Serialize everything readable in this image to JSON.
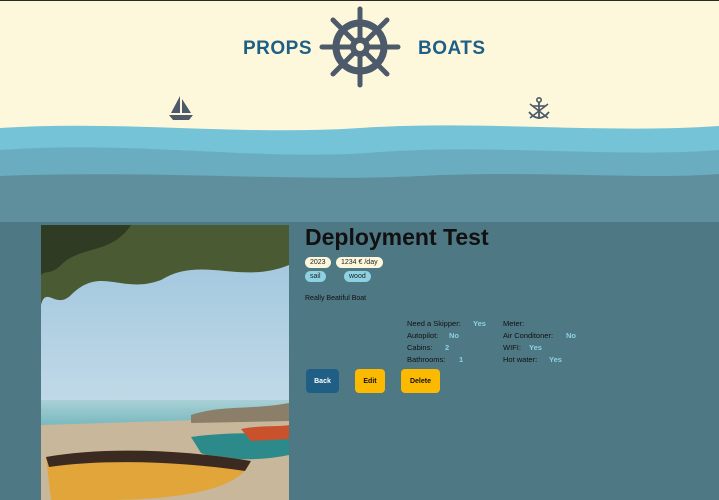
{
  "header": {
    "brand_left": "PROPS",
    "brand_right": "BOATS",
    "logo_icon": "ship-wheel-icon",
    "left_icon": "sailboat-icon",
    "right_icon": "anchor-icon"
  },
  "boat": {
    "title": "Deployment Test",
    "year": "2023",
    "price": "1234 € /day",
    "tags": [
      "sail",
      "wood"
    ],
    "description": "Really Beatiful Boat",
    "specs_left": [
      {
        "label": "Need a Skipper:",
        "value": "Yes"
      },
      {
        "label": "Autopilot:",
        "value": "No"
      },
      {
        "label": "Cabins:",
        "value": "2"
      },
      {
        "label": "Bathrooms:",
        "value": "1"
      }
    ],
    "specs_right": [
      {
        "label": "Meter:",
        "value": ""
      },
      {
        "label": "Air Conditoner:",
        "value": "No"
      },
      {
        "label": "WIFI:",
        "value": "Yes"
      },
      {
        "label": "Hot water:",
        "value": "Yes"
      }
    ]
  },
  "actions": {
    "back": "Back",
    "edit": "Edit",
    "delete": "Delete"
  },
  "colors": {
    "cream": "#fdf7dc",
    "brand_blue": "#1f5f86",
    "accent_yellow": "#fbb900",
    "light_cyan": "#8dd1e2",
    "page_bg": "#4e7884"
  }
}
